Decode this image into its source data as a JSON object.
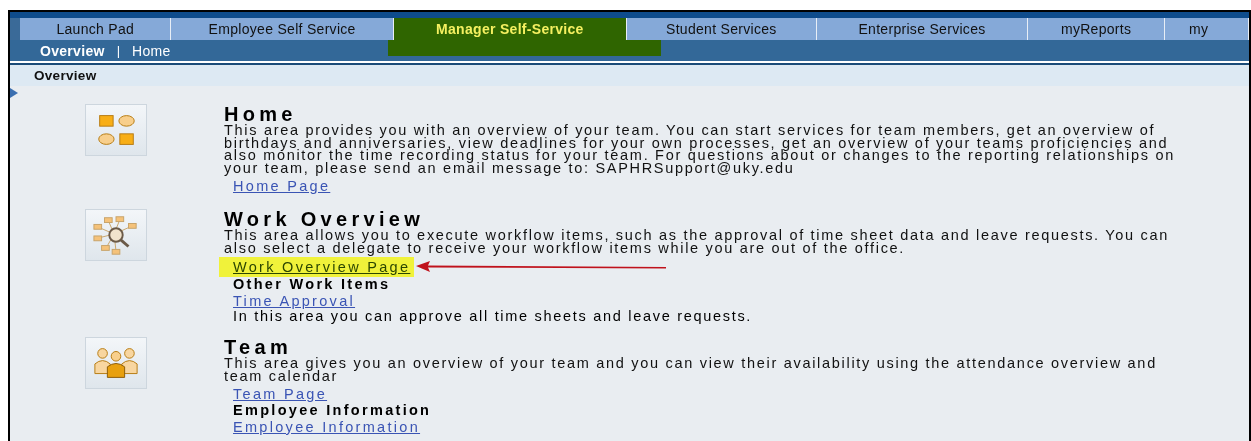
{
  "tabs": [
    {
      "label": "Launch Pad",
      "selected": false
    },
    {
      "label": "Employee Self Service",
      "selected": false
    },
    {
      "label": "Manager Self-Service",
      "selected": true
    },
    {
      "label": "Student Services",
      "selected": false
    },
    {
      "label": "Enterprise Services",
      "selected": false
    },
    {
      "label": "myReports",
      "selected": false
    },
    {
      "label": "my",
      "selected": false
    }
  ],
  "subnav_separator": "|",
  "subnav": [
    {
      "label": "Overview",
      "selected": true
    },
    {
      "label": "Home",
      "selected": false
    }
  ],
  "page_title": "Overview",
  "sections": [
    {
      "title": "Home",
      "description": "This area provides you with an overview of your team. You can start services for team members, get an overview of birthdays and anniversaries, view deadlines for your own processes, get an overview of your teams proficiencies and also monitor the time recording status for your team. For questions about or changes to the reporting relationships on your team, please send an email message to: SAPHRSupport@uky.edu",
      "items": [
        {
          "kind": "link",
          "text": "Home Page",
          "highlighted": false,
          "arrow": false
        }
      ]
    },
    {
      "title": "Work Overview",
      "description": "This area allows you to execute workflow items, such as the approval of time sheet data and leave requests. You can also select a delegate to receive your workflow items while you are out of the office.",
      "items": [
        {
          "kind": "link",
          "text": "Work Overview Page",
          "highlighted": true,
          "arrow": true
        },
        {
          "kind": "label",
          "text": "Other Work Items"
        },
        {
          "kind": "link",
          "text": "Time Approval",
          "highlighted": false,
          "arrow": false
        },
        {
          "kind": "text",
          "text": "In this area you can approve all time sheets and leave requests."
        }
      ]
    },
    {
      "title": "Team",
      "description": "This area gives you an overview of your team and you can view their availability using the attendance overview and team calendar",
      "items": [
        {
          "kind": "link",
          "text": "Team Page",
          "highlighted": false,
          "arrow": false
        },
        {
          "kind": "label",
          "text": "Employee Information"
        },
        {
          "kind": "link",
          "text": "Employee Information",
          "highlighted": false,
          "arrow": false
        }
      ]
    }
  ]
}
